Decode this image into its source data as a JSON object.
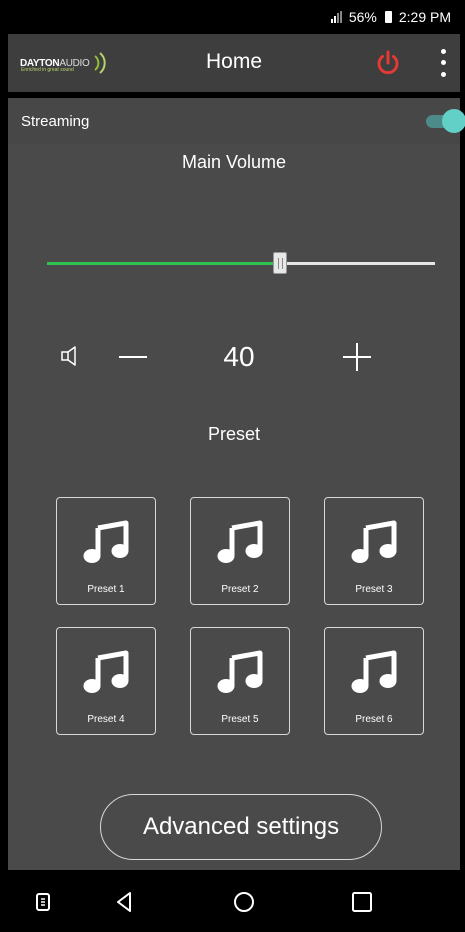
{
  "status_bar": {
    "battery": "56%",
    "time": "2:29 PM"
  },
  "app_bar": {
    "logo": {
      "brand_bold": "DAYTON",
      "brand_light": "AUDIO",
      "tagline": "Enriched in great sound"
    },
    "title": "Home",
    "power_color": "#e53935"
  },
  "streaming": {
    "label": "Streaming",
    "enabled": true,
    "accent": "#63d0c7"
  },
  "volume": {
    "title": "Main Volume",
    "value": "40",
    "slider_percent": 60,
    "fill_color": "#2ec24e"
  },
  "presets": {
    "title": "Preset",
    "items": [
      {
        "label": "Preset 1",
        "icon": "music-note-icon"
      },
      {
        "label": "Preset 2",
        "icon": "music-note-icon"
      },
      {
        "label": "Preset 3",
        "icon": "music-note-icon"
      },
      {
        "label": "Preset 4",
        "icon": "music-note-icon"
      },
      {
        "label": "Preset 5",
        "icon": "music-note-icon"
      },
      {
        "label": "Preset 6",
        "icon": "music-note-icon"
      }
    ]
  },
  "advanced_button": {
    "label": "Advanced settings"
  },
  "nav_bar": {
    "icons": [
      "recent-apps-drawer-icon",
      "back-icon",
      "home-icon",
      "overview-icon"
    ]
  }
}
